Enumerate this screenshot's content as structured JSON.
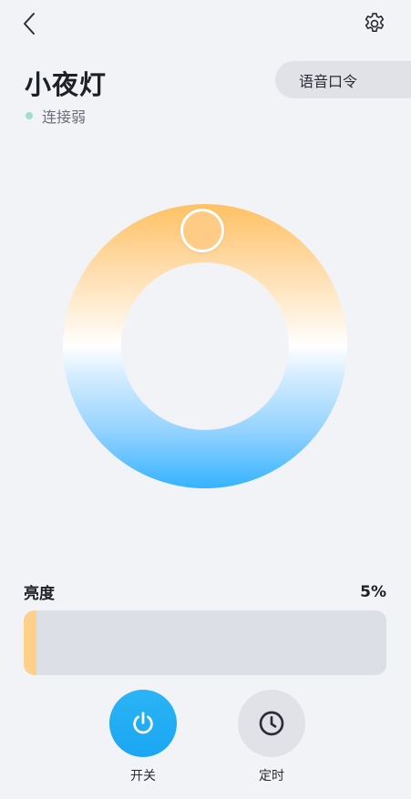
{
  "header": {
    "back_icon": "chevron-left-icon",
    "settings_icon": "gear-icon"
  },
  "device": {
    "name": "小夜灯",
    "status": "连接弱",
    "status_color": "#9ee0cc",
    "voice_command_label": "语音口令"
  },
  "color_wheel": {
    "warm_color": "#ffc163",
    "cool_color": "#35b3ff",
    "selected_color": "#ffcb85"
  },
  "brightness": {
    "label": "亮度",
    "value_text": "5%",
    "value": 0.05,
    "fill_color": "#ffd08a"
  },
  "controls": {
    "power": {
      "label": "开关",
      "icon": "power-icon",
      "color": "#1aa6f2"
    },
    "timer": {
      "label": "定时",
      "icon": "clock-icon"
    }
  }
}
